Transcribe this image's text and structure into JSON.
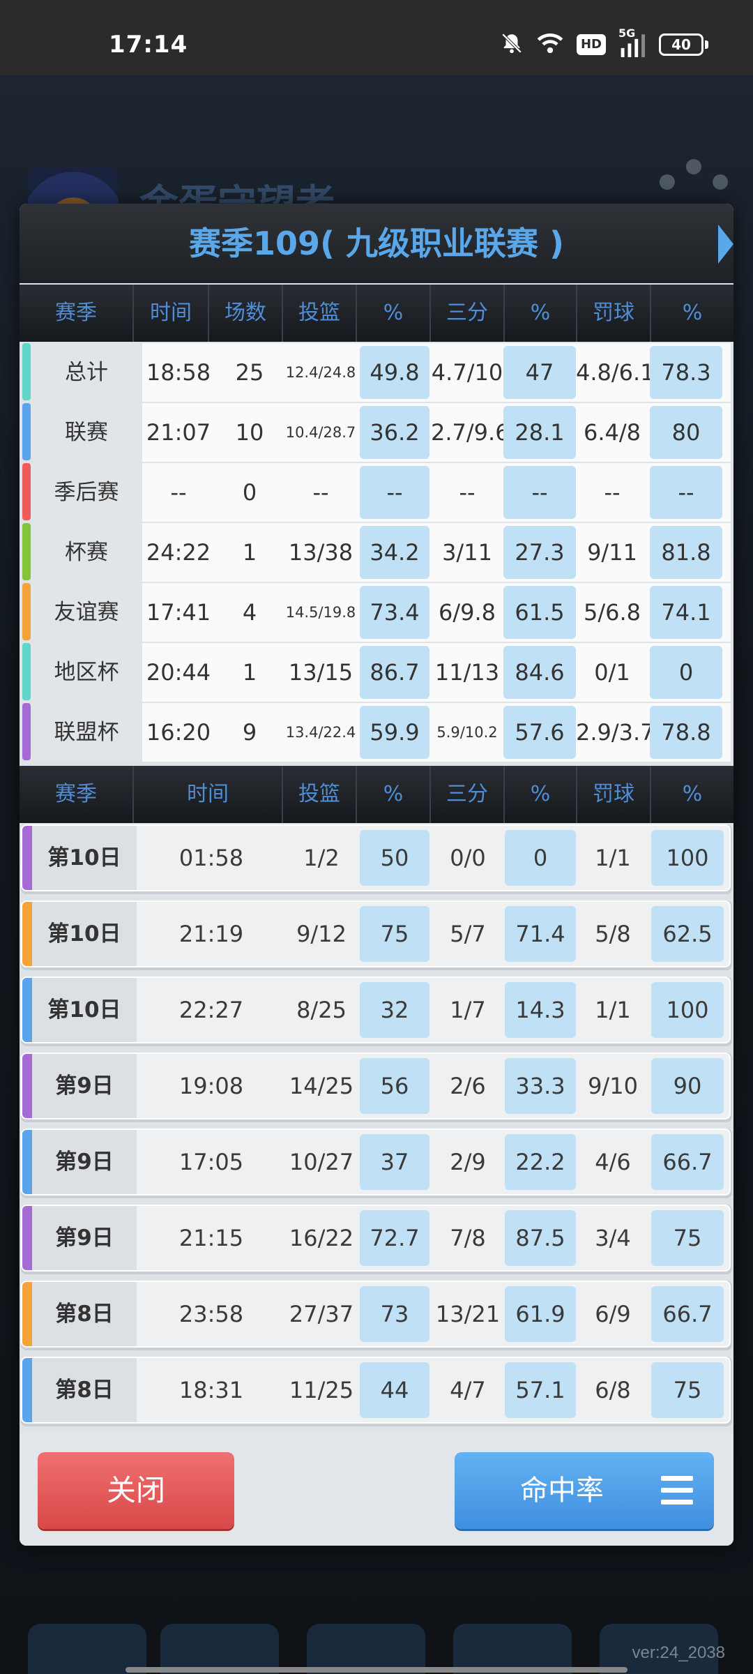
{
  "status_bar": {
    "time": "17:14",
    "hd": "HD",
    "signal": "5G",
    "battery": "40"
  },
  "background": {
    "team_name": "金蛋守望者",
    "version": "ver:24_2038"
  },
  "modal": {
    "title": "赛季109( 九级职业联赛 )",
    "summary_headers": [
      "赛季",
      "时间",
      "场数",
      "投篮",
      "%",
      "三分",
      "%",
      "罚球",
      "%"
    ],
    "summary_rows": [
      {
        "label": "总计",
        "stripe": "#5fd6c8",
        "time": "18:58",
        "games": "25",
        "fg": "12.4/24.8",
        "fg_pct": "49.8",
        "three": "4.7/10",
        "three_pct": "47",
        "ft": "4.8/6.1",
        "ft_pct": "78.3"
      },
      {
        "label": "联赛",
        "stripe": "#5aa4ee",
        "time": "21:07",
        "games": "10",
        "fg": "10.4/28.7",
        "fg_pct": "36.2",
        "three": "2.7/9.6",
        "three_pct": "28.1",
        "ft": "6.4/8",
        "ft_pct": "80"
      },
      {
        "label": "季后赛",
        "stripe": "#ef5b5b",
        "time": "--",
        "games": "0",
        "fg": "--",
        "fg_pct": "--",
        "three": "--",
        "three_pct": "--",
        "ft": "--",
        "ft_pct": "--"
      },
      {
        "label": "杯赛",
        "stripe": "#84c43a",
        "time": "24:22",
        "games": "1",
        "fg": "13/38",
        "fg_pct": "34.2",
        "three": "3/11",
        "three_pct": "27.3",
        "ft": "9/11",
        "ft_pct": "81.8"
      },
      {
        "label": "友谊赛",
        "stripe": "#f5a23a",
        "time": "17:41",
        "games": "4",
        "fg": "14.5/19.8",
        "fg_pct": "73.4",
        "three": "6/9.8",
        "three_pct": "61.5",
        "ft": "5/6.8",
        "ft_pct": "74.1"
      },
      {
        "label": "地区杯",
        "stripe": "#5fd6c8",
        "time": "20:44",
        "games": "1",
        "fg": "13/15",
        "fg_pct": "86.7",
        "three": "11/13",
        "three_pct": "84.6",
        "ft": "0/1",
        "ft_pct": "0"
      },
      {
        "label": "联盟杯",
        "stripe": "#a46ad6",
        "time": "16:20",
        "games": "9",
        "fg": "13.4/22.4",
        "fg_pct": "59.9",
        "three": "5.9/10.2",
        "three_pct": "57.6",
        "ft": "2.9/3.7",
        "ft_pct": "78.8"
      }
    ],
    "game_headers": [
      "赛季",
      "时间",
      "投篮",
      "%",
      "三分",
      "%",
      "罚球",
      "%"
    ],
    "game_rows": [
      {
        "label": "第10日",
        "stripe": "#a46ad6",
        "time": "01:58",
        "fg": "1/2",
        "fg_pct": "50",
        "three": "0/0",
        "three_pct": "0",
        "ft": "1/1",
        "ft_pct": "100"
      },
      {
        "label": "第10日",
        "stripe": "#f5a23a",
        "time": "21:19",
        "fg": "9/12",
        "fg_pct": "75",
        "three": "5/7",
        "three_pct": "71.4",
        "ft": "5/8",
        "ft_pct": "62.5"
      },
      {
        "label": "第10日",
        "stripe": "#5aa4ee",
        "time": "22:27",
        "fg": "8/25",
        "fg_pct": "32",
        "three": "1/7",
        "three_pct": "14.3",
        "ft": "1/1",
        "ft_pct": "100"
      },
      {
        "label": "第9日",
        "stripe": "#a46ad6",
        "time": "19:08",
        "fg": "14/25",
        "fg_pct": "56",
        "three": "2/6",
        "three_pct": "33.3",
        "ft": "9/10",
        "ft_pct": "90"
      },
      {
        "label": "第9日",
        "stripe": "#5aa4ee",
        "time": "17:05",
        "fg": "10/27",
        "fg_pct": "37",
        "three": "2/9",
        "three_pct": "22.2",
        "ft": "4/6",
        "ft_pct": "66.7"
      },
      {
        "label": "第9日",
        "stripe": "#a46ad6",
        "time": "21:15",
        "fg": "16/22",
        "fg_pct": "72.7",
        "three": "7/8",
        "three_pct": "87.5",
        "ft": "3/4",
        "ft_pct": "75"
      },
      {
        "label": "第8日",
        "stripe": "#f5a23a",
        "time": "23:58",
        "fg": "27/37",
        "fg_pct": "73",
        "three": "13/21",
        "three_pct": "61.9",
        "ft": "6/9",
        "ft_pct": "66.7"
      },
      {
        "label": "第8日",
        "stripe": "#5aa4ee",
        "time": "18:31",
        "fg": "11/25",
        "fg_pct": "44",
        "three": "4/7",
        "three_pct": "57.1",
        "ft": "6/8",
        "ft_pct": "75"
      }
    ],
    "close_label": "关闭",
    "rate_label": "命中率"
  },
  "colors": {
    "accent": "#5aa8ea",
    "pct_cell": "#bfe0f5",
    "close_button": "#e25656",
    "rate_button": "#4a9ce8"
  }
}
